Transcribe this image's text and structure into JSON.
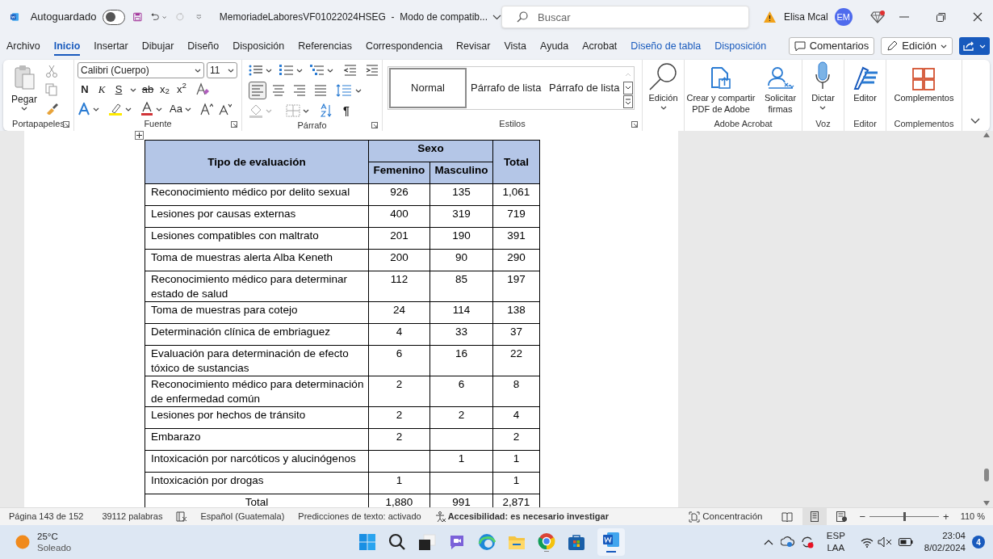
{
  "title_bar": {
    "autosave_label": "Autoguardado",
    "autosave_on": false,
    "document_title": "MemoriadeLaboresVF01022024HSEG  -  Modo de compatib...",
    "search_placeholder": "Buscar",
    "user_name": "Elisa Mcal",
    "user_initials": "EM"
  },
  "menu_tabs": [
    {
      "label": "Archivo",
      "selected": false,
      "kind": "standard"
    },
    {
      "label": "Inicio",
      "selected": true,
      "kind": "standard"
    },
    {
      "label": "Insertar",
      "selected": false,
      "kind": "standard"
    },
    {
      "label": "Dibujar",
      "selected": false,
      "kind": "standard"
    },
    {
      "label": "Diseño",
      "selected": false,
      "kind": "standard"
    },
    {
      "label": "Disposición",
      "selected": false,
      "kind": "standard"
    },
    {
      "label": "Referencias",
      "selected": false,
      "kind": "standard"
    },
    {
      "label": "Correspondencia",
      "selected": false,
      "kind": "standard"
    },
    {
      "label": "Revisar",
      "selected": false,
      "kind": "standard"
    },
    {
      "label": "Vista",
      "selected": false,
      "kind": "standard"
    },
    {
      "label": "Ayuda",
      "selected": false,
      "kind": "standard"
    },
    {
      "label": "Acrobat",
      "selected": false,
      "kind": "standard"
    },
    {
      "label": "Diseño de tabla",
      "selected": false,
      "kind": "contextual"
    },
    {
      "label": "Disposición",
      "selected": false,
      "kind": "contextual"
    }
  ],
  "header_buttons": {
    "comments": "Comentarios",
    "editing": "Edición"
  },
  "ribbon": {
    "clipboard": {
      "paste": "Pegar",
      "label": "Portapapeles"
    },
    "font": {
      "name": "Calibri (Cuerpo)",
      "size": "11",
      "label": "Fuente",
      "format_buttons": [
        "N",
        "K",
        "S",
        "ab",
        "x$_{2}$",
        "x$^{2}$"
      ],
      "case_button": "Aa"
    },
    "paragraph": {
      "label": "Párrafo",
      "show_marks": "¶",
      "alignments": [
        {
          "selected": true
        },
        {
          "selected": false
        },
        {
          "selected": false
        },
        {
          "selected": false
        }
      ]
    },
    "styles": {
      "label": "Estilos",
      "items": [
        {
          "label": "Normal",
          "selected": true
        },
        {
          "label": "Párrafo de lista",
          "selected": false
        },
        {
          "label": "Párrafo de lista",
          "selected": false
        }
      ]
    },
    "groups": [
      {
        "buttons": [
          {
            "kind": "find",
            "label": "Edición",
            "dropdown": true
          }
        ]
      },
      {
        "label": "Adobe Acrobat",
        "buttons": [
          {
            "kind": "pdf",
            "label": "Crear y compartir PDF de Adobe",
            "dropdown": false
          },
          {
            "kind": "signature",
            "label": "Solicitar firmas",
            "dropdown": false
          }
        ]
      },
      {
        "label": "Voz",
        "buttons": [
          {
            "kind": "mic",
            "label": "Dictar",
            "dropdown": true
          }
        ]
      },
      {
        "label": "Editor",
        "buttons": [
          {
            "kind": "editor",
            "label": "Editor",
            "dropdown": false
          }
        ]
      },
      {
        "label": "Complementos",
        "buttons": [
          {
            "kind": "addins",
            "label": "Complementos",
            "dropdown": false
          }
        ]
      }
    ]
  },
  "table": {
    "header": {
      "type": "Tipo de evaluación",
      "sex": "Sexo",
      "female": "Femenino",
      "male": "Masculino",
      "total": "Total"
    },
    "rows": [
      {
        "label": "Reconocimiento médico por delito sexual",
        "female": "926",
        "male": "135",
        "total": "1,061"
      },
      {
        "label": "Lesiones por causas externas",
        "female": "400",
        "male": "319",
        "total": "719"
      },
      {
        "label": "Lesiones compatibles con maltrato",
        "female": "201",
        "male": "190",
        "total": "391"
      },
      {
        "label": "Toma de muestras alerta Alba Keneth",
        "female": "200",
        "male": "90",
        "total": "290"
      },
      {
        "label": "Reconocimiento médico para determinar estado de salud",
        "female": "112",
        "male": "85",
        "total": "197"
      },
      {
        "label": "Toma de muestras para cotejo",
        "female": "24",
        "male": "114",
        "total": "138"
      },
      {
        "label": "Determinación clínica de embriaguez",
        "female": "4",
        "male": "33",
        "total": "37"
      },
      {
        "label": "Evaluación para determinación de efecto tóxico de sustancias",
        "female": "6",
        "male": "16",
        "total": "22"
      },
      {
        "label": "Reconocimiento médico para determinación de enfermedad común",
        "female": "2",
        "male": "6",
        "total": "8"
      },
      {
        "label": "Lesiones por hechos de tránsito",
        "female": "2",
        "male": "2",
        "total": "4"
      },
      {
        "label": "Embarazo",
        "female": "2",
        "total": "2"
      },
      {
        "label": "Intoxicación por narcóticos y alucinógenos",
        "male": "1",
        "total": "1"
      },
      {
        "label": "Intoxicación por drogas",
        "female": "1",
        "total": "1"
      }
    ],
    "total_row": {
      "label": "Total",
      "female": "1,880",
      "male": "991",
      "total": "2,871"
    }
  },
  "status_bar": {
    "page": "Página 143 de 152",
    "words": "39112 palabras",
    "language": "Español (Guatemala)",
    "predictions": "Predicciones de texto: activado",
    "accessibility": "Accesibilidad: es necesario investigar",
    "focus": "Concentración",
    "zoom": "110 %",
    "zoom_out": "−",
    "zoom_in": "+",
    "level": 0.5
  },
  "taskbar": {
    "temperature": "25°C",
    "weather": "Soleado",
    "lang1": "ESP",
    "lang2": "LAA",
    "time": "23:04",
    "date": "8/02/2024",
    "notifications": "4"
  }
}
